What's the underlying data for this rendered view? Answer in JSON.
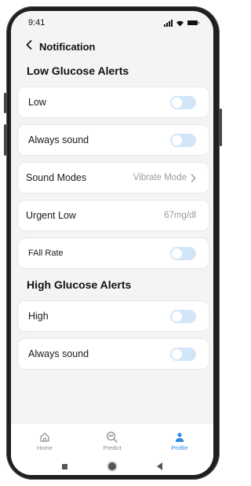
{
  "status_bar": {
    "time": "9:41",
    "icons": [
      "signal-icon",
      "wifi-icon",
      "battery-icon"
    ]
  },
  "header": {
    "back_icon": "chevron-left-icon",
    "title": "Notification"
  },
  "low_section": {
    "title": "Low Glucose Alerts",
    "rows": [
      {
        "label": "Low",
        "type": "toggle",
        "on": false
      },
      {
        "label": "Always sound",
        "type": "toggle",
        "on": false
      },
      {
        "label": "Sound Modes",
        "type": "select",
        "value": "Vibrate Mode"
      },
      {
        "label": "Urgent Low",
        "type": "value",
        "value": "67mg/dl"
      },
      {
        "label": "FAll Rate",
        "type": "toggle",
        "on": false
      }
    ]
  },
  "high_section": {
    "title": "High Glucose Alerts",
    "rows": [
      {
        "label": "High",
        "type": "toggle",
        "on": false
      },
      {
        "label": "Always sound",
        "type": "toggle",
        "on": false
      }
    ]
  },
  "tabbar": {
    "items": [
      {
        "label": "Home",
        "icon": "home-icon",
        "active": false
      },
      {
        "label": "Predict",
        "icon": "predict-icon",
        "active": false
      },
      {
        "label": "Profile",
        "icon": "profile-icon",
        "active": true
      }
    ]
  },
  "colors": {
    "accent": "#2f8ae0",
    "toggle_off": "#d3e6f8",
    "background": "#f4f4f6"
  }
}
